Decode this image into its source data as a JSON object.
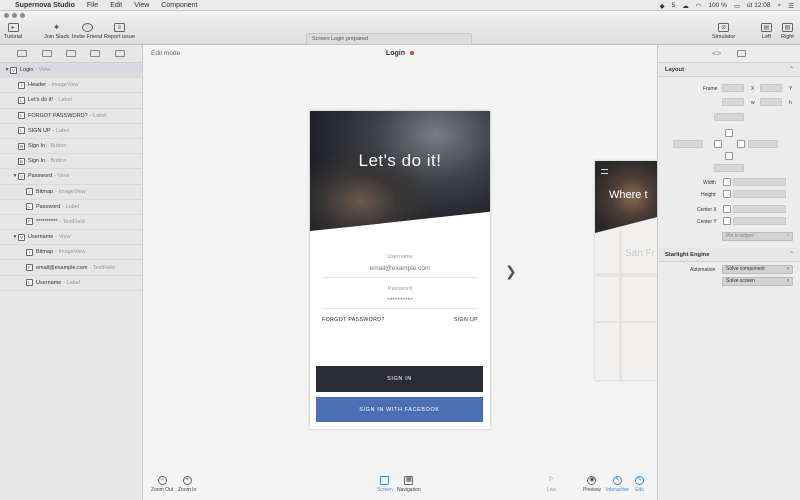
{
  "menubar": {
    "apple_icon": "apple-icon",
    "app_name": "Supernova Studio",
    "items": [
      "File",
      "Edit",
      "View",
      "Component"
    ],
    "battery_percent": "100 %",
    "time": "út 12:08",
    "badge_count": "5"
  },
  "toolbar": {
    "tutorial": "Tutorial",
    "join_slack": "Join Slack",
    "invite_friend": "Invite Friend",
    "report_issue": "Report issue",
    "status": "Screen Login prepared",
    "simulator": "Simulator",
    "left": "Left",
    "right": "Right"
  },
  "sidebar": {
    "items": [
      {
        "label": "Login",
        "type": "- View",
        "icon": "V",
        "indent": 0,
        "expanded": true
      },
      {
        "label": "Header",
        "type": "- ImageView",
        "icon": "I",
        "indent": 1
      },
      {
        "label": "Let's do it!",
        "type": "- Label",
        "icon": "L",
        "indent": 1
      },
      {
        "label": "FORGOT PASSWORD?",
        "type": "- Label",
        "icon": "L",
        "indent": 1
      },
      {
        "label": "SIGN UP",
        "type": "- Label",
        "icon": "L",
        "indent": 1
      },
      {
        "label": "Sign In",
        "type": "- Button",
        "icon": "B",
        "indent": 1
      },
      {
        "label": "Sign In",
        "type": "- Button",
        "icon": "B",
        "indent": 1
      },
      {
        "label": "Password",
        "type": "- View",
        "icon": "V",
        "indent": 1,
        "expanded": true
      },
      {
        "label": "Bitmap",
        "type": "- ImageView",
        "icon": "I",
        "indent": 2
      },
      {
        "label": "Password",
        "type": "- Label",
        "icon": "L",
        "indent": 2
      },
      {
        "label": "**********",
        "type": "- TextField",
        "icon": "F",
        "indent": 2
      },
      {
        "label": "Username",
        "type": "- View",
        "icon": "V",
        "indent": 1,
        "expanded": true
      },
      {
        "label": "Bitmap",
        "type": "- ImageView",
        "icon": "I",
        "indent": 2
      },
      {
        "label": "email@example.com",
        "type": "- TextField",
        "icon": "F",
        "indent": 2
      },
      {
        "label": "Username",
        "type": "- Label",
        "icon": "L",
        "indent": 2
      }
    ]
  },
  "canvas": {
    "mode": "Edit mode",
    "screen_title": "Login",
    "phone": {
      "hero_text": "Let's do it!",
      "username_label": "Username",
      "username_value": "email@example.com",
      "password_label": "Password",
      "password_value": "**********",
      "forgot": "FORGOT PASSWORD?",
      "signup": "SIGN UP",
      "signin": "SIGN IN",
      "signin_fb": "SIGN IN WITH FACEBOOK"
    },
    "next_screen": {
      "hero_text": "Where t",
      "map_text": "San Fr"
    }
  },
  "bottom": {
    "zoom_out": "Zoom Out",
    "zoom_in": "Zoom In",
    "screen": "Screen",
    "navigation": "Navigation",
    "live": "Live",
    "preview": "Preview",
    "interactive": "Interactive",
    "edit": "Edit"
  },
  "inspector": {
    "layout_title": "Layout",
    "frame": "Frame",
    "x": "X",
    "y": "Y",
    "w": "w",
    "h": "h",
    "width": "Width",
    "height": "Height",
    "center_x": "Center X",
    "center_y": "Center Y",
    "pin_to_edges": "Pin to edges",
    "engine_title": "Starlight Engine",
    "automation": "Automation",
    "solve_component": "Solve component",
    "solve_screen": "Solve screen"
  },
  "colors": {
    "signin_bg": "#2b2b35",
    "facebook_bg": "#4a6fb5",
    "accent_blue": "#3a8ee6",
    "unsaved_dot": "#e0403a"
  }
}
